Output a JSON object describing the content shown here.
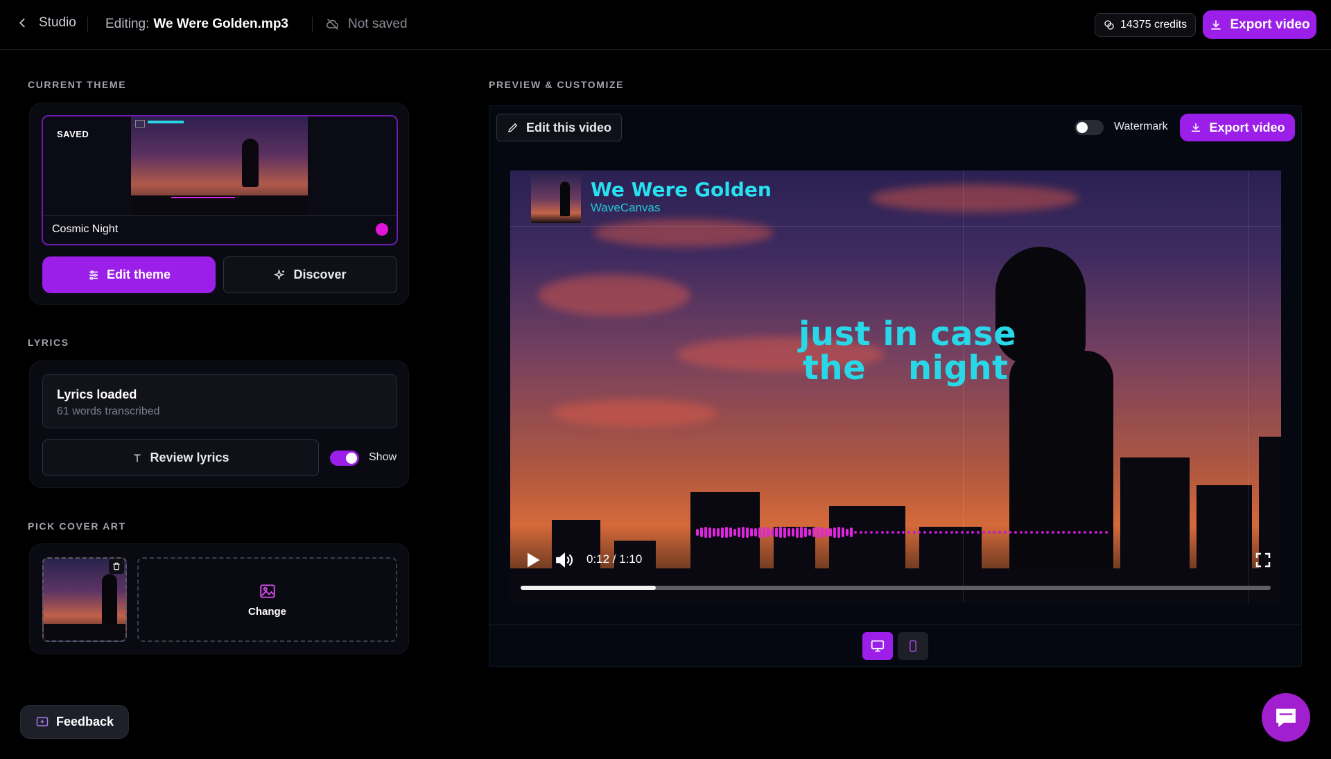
{
  "topbar": {
    "back_label": "Studio",
    "editing_label": "Editing:",
    "file_name": "We Were Golden.mp3",
    "save_status": "Not saved",
    "credits": "14375 credits",
    "export_label": "Export video"
  },
  "theme": {
    "section_label": "CURRENT THEME",
    "saved_badge": "SAVED",
    "name": "Cosmic Night",
    "color": "#e214d8",
    "edit_label": "Edit theme",
    "discover_label": "Discover"
  },
  "lyrics": {
    "section_label": "LYRICS",
    "status_title": "Lyrics loaded",
    "status_sub": "61 words transcribed",
    "review_label": "Review lyrics",
    "show_label": "Show",
    "show_enabled": true
  },
  "cover": {
    "section_label": "PICK COVER ART",
    "change_label": "Change"
  },
  "feedback_label": "Feedback",
  "preview": {
    "section_label": "PREVIEW & CUSTOMIZE",
    "edit_video_label": "Edit this video",
    "watermark_label": "Watermark",
    "watermark_enabled": false,
    "export_label": "Export video",
    "video_title": "We Were Golden",
    "video_artist": "WaveCanvas",
    "lyric_line_1": "just in case",
    "lyric_line_2a": "the",
    "lyric_line_2b": "night",
    "time": "0:12 / 1:10",
    "progress": 0.18,
    "device_selected": "desktop"
  },
  "colors": {
    "accent": "#9b1fe9",
    "lyric": "#28d8e8",
    "waveform": "#e024e0"
  }
}
